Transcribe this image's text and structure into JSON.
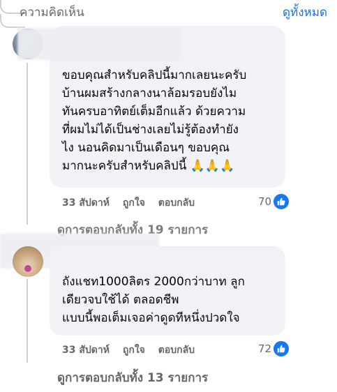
{
  "header": {
    "title": "ความคิดเห็น",
    "see_all": "ดูทั้งหมด"
  },
  "comments": [
    {
      "text": "ขอบคุณสำหรับคลิปนี้มากเลยนะครับ\nบ้านผมสร้างกลางนาล้อมรอบยังไม\nทันครบอาทิตย์เต็มอีกแล้ว ด้วยความ\nที่ผมไม่ได้เป็นช่างเลยไม่รู้ต้องทำยัง\nไง นอนคิดมาเป็นเดือนๆ ขอบคุณ\nมากนะครับสำหรับคลิปนี้ 🙏🙏🙏",
      "time": "33 สัปดาห์",
      "like_label": "ถูกใจ",
      "reply_label": "ตอบกลับ",
      "reaction_count": "70",
      "reaction_icon": "like-icon",
      "replies_link": "ดูการตอบกลับทั้ง 19 รายการ"
    },
    {
      "text": "ถังแชท1000ลิตร 2000กว่าบาท ลูก\nเดียวจบใช้ได้ ตลอดชีพ\nแบบนี้พอเต็มเจอค่าดูดทีหนึ่งปวดใจ",
      "time": "33 สัปดาห์",
      "like_label": "ถูกใจ",
      "reply_label": "ตอบกลับ",
      "reaction_count": "72",
      "reaction_icon": "like-icon",
      "replies_link": "ดูการตอบกลับทั้ง 13 รายการ"
    }
  ],
  "colors": {
    "link": "#1b74e4",
    "bubble": "#f0f2f5",
    "muted": "#65676b",
    "like": "#1877f2"
  }
}
